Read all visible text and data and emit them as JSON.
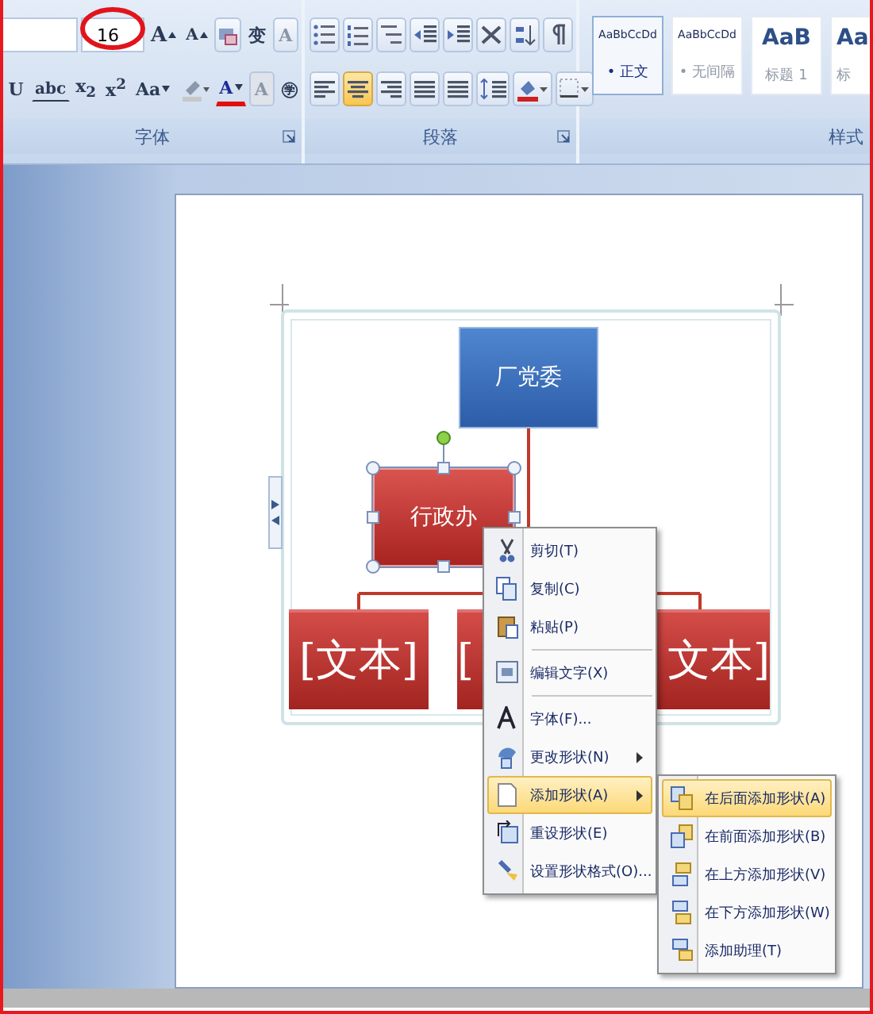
{
  "ribbon": {
    "font_group": {
      "label": "字体",
      "font_size": "16",
      "row1": [
        {
          "kind": "grow",
          "glyph": "A"
        },
        {
          "kind": "shrink",
          "glyph": "A"
        },
        {
          "kind": "clear"
        },
        {
          "kind": "text",
          "glyph": "变"
        },
        {
          "kind": "boxed",
          "glyph": "A"
        }
      ],
      "row2": [
        {
          "kind": "text",
          "glyph": "U"
        },
        {
          "kind": "strike",
          "glyph": "abc"
        },
        {
          "kind": "text",
          "glyph": "x$_{2}$"
        },
        {
          "kind": "text",
          "glyph": "x$^{2}$"
        },
        {
          "kind": "drop",
          "glyph": "Aa"
        },
        {
          "kind": "highlight"
        },
        {
          "kind": "color",
          "glyph": "A"
        },
        {
          "kind": "shaded",
          "glyph": "A"
        },
        {
          "kind": "text",
          "glyph": "㊫"
        }
      ],
      "annotation": {
        "kind": "ellipse",
        "color": "#e0151b"
      }
    },
    "paragraph_group": {
      "label": "段落",
      "alignments": [
        {
          "selected": false
        },
        {
          "selected": true
        },
        {
          "selected": false
        },
        {
          "selected": false
        },
        {
          "selected": false
        }
      ]
    },
    "styles_group": {
      "label": "样式",
      "styles": [
        {
          "sample": "AaBbCcDd",
          "name": "• 正文",
          "kind": "body",
          "selected": true
        },
        {
          "sample": "AaBbCcDd",
          "name": "• 无间隔",
          "kind": "body",
          "selected": false
        },
        {
          "sample": "AaB",
          "name": "标题 1",
          "kind": "heading",
          "selected": false
        },
        {
          "sample": "Aa",
          "name": "标",
          "kind": "heading",
          "selected": false
        }
      ]
    }
  },
  "smartart": {
    "nodes": [
      {
        "text": "厂党委",
        "kind": "top",
        "selected": false
      },
      {
        "text": "行政办",
        "kind": "assistant",
        "selected": true
      },
      {
        "text": "[文本]",
        "kind": "child"
      },
      {
        "text": "[",
        "kind": "child"
      },
      {
        "text": "文本]",
        "kind": "child"
      }
    ]
  },
  "context_menu": {
    "items": [
      {
        "kind": "item",
        "label": "剪切(T)",
        "selected": false,
        "submenu": false
      },
      {
        "kind": "item",
        "label": "复制(C)",
        "selected": false,
        "submenu": false
      },
      {
        "kind": "item",
        "label": "粘贴(P)",
        "selected": false,
        "submenu": false
      },
      {
        "kind": "separator"
      },
      {
        "kind": "item",
        "label": "编辑文字(X)",
        "selected": false,
        "submenu": false
      },
      {
        "kind": "separator"
      },
      {
        "kind": "item",
        "label": "字体(F)...",
        "selected": false,
        "submenu": false
      },
      {
        "kind": "item",
        "label": "更改形状(N)",
        "selected": false,
        "submenu": true
      },
      {
        "kind": "item",
        "label": "添加形状(A)",
        "selected": true,
        "submenu": true
      },
      {
        "kind": "item",
        "label": "重设形状(E)",
        "selected": false,
        "submenu": false
      },
      {
        "kind": "item",
        "label": "设置形状格式(O)...",
        "selected": false,
        "submenu": false
      }
    ]
  },
  "submenu": {
    "items": [
      {
        "label": "在后面添加形状(A)",
        "selected": true
      },
      {
        "label": "在前面添加形状(B)",
        "selected": false
      },
      {
        "label": "在上方添加形状(V)",
        "selected": false
      },
      {
        "label": "在下方添加形状(W)",
        "selected": false
      },
      {
        "label": "添加助理(T)",
        "selected": false
      }
    ]
  }
}
